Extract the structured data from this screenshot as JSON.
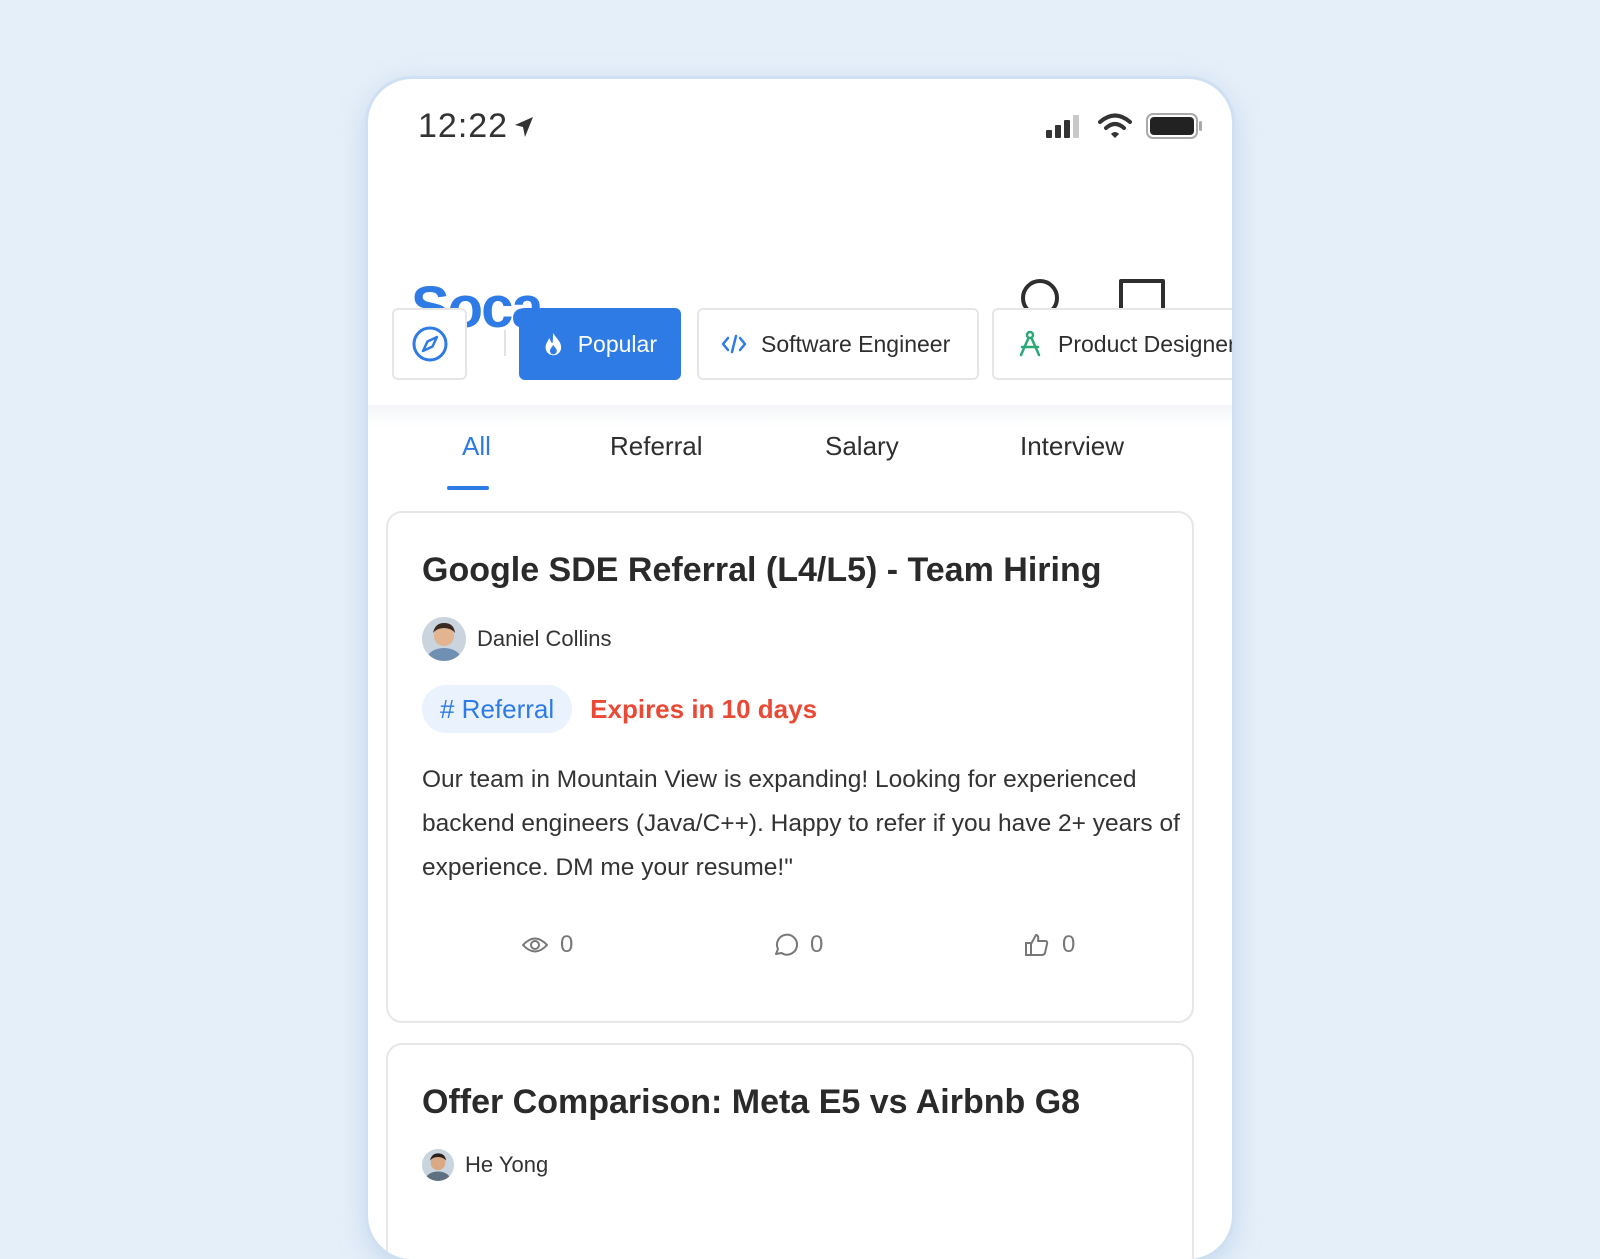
{
  "status_bar": {
    "time": "12:22"
  },
  "app": {
    "logo": "Soca"
  },
  "header": {
    "search_icon": "search-icon",
    "messages_icon": "chat-icon"
  },
  "chips": [
    {
      "label": "",
      "icon": "compass-icon"
    },
    {
      "label": "Popular",
      "icon": "flame-icon"
    },
    {
      "label": "Software Engineer",
      "icon": "code-icon"
    },
    {
      "label": "Product Designer",
      "icon": "design-tool-icon"
    }
  ],
  "tabs": [
    {
      "label": "All"
    },
    {
      "label": "Referral"
    },
    {
      "label": "Salary"
    },
    {
      "label": "Interview"
    }
  ],
  "posts": [
    {
      "title": "Google SDE Referral (L4/L5) - Team Hiring",
      "author": "Daniel Collins",
      "tag": "# Referral",
      "expires": "Expires in 10 days",
      "body": "Our team in Mountain View is expanding! Looking for experienced backend engineers (Java/C++). Happy to refer if you have 2+ years of experience. DM me your resume!\"",
      "views": "0",
      "comments": "0",
      "likes": "0"
    },
    {
      "title": "Offer Comparison: Meta E5 vs Airbnb G8",
      "author": "He Yong"
    }
  ],
  "colors": {
    "accent": "#2f7be5",
    "expires": "#ea4a35",
    "background": "#e5eff9"
  }
}
